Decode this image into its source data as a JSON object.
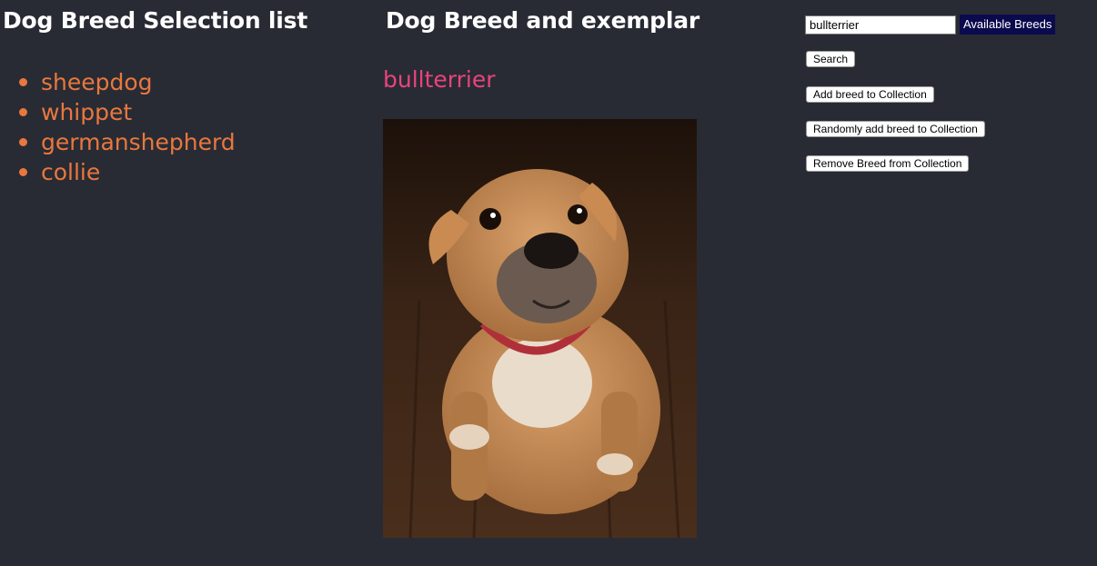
{
  "left_panel": {
    "title": "Dog Breed Selection list",
    "breeds": [
      "sheepdog",
      "whippet",
      "germanshepherd",
      "collie"
    ]
  },
  "middle_panel": {
    "title": "Dog Breed and exemplar",
    "selected_breed": "bullterrier"
  },
  "controls": {
    "search_value": "bullterrier",
    "available_label": "Available Breeds",
    "search_button": "Search",
    "add_button": "Add breed to Collection",
    "random_add_button": "Randomly add breed to Collection",
    "remove_button": "Remove Breed from Collection"
  },
  "colors": {
    "background": "#282b33",
    "list_text": "#e9773f",
    "selected_breed_text": "#e9437e",
    "available_label_bg": "#0b0a4d"
  }
}
